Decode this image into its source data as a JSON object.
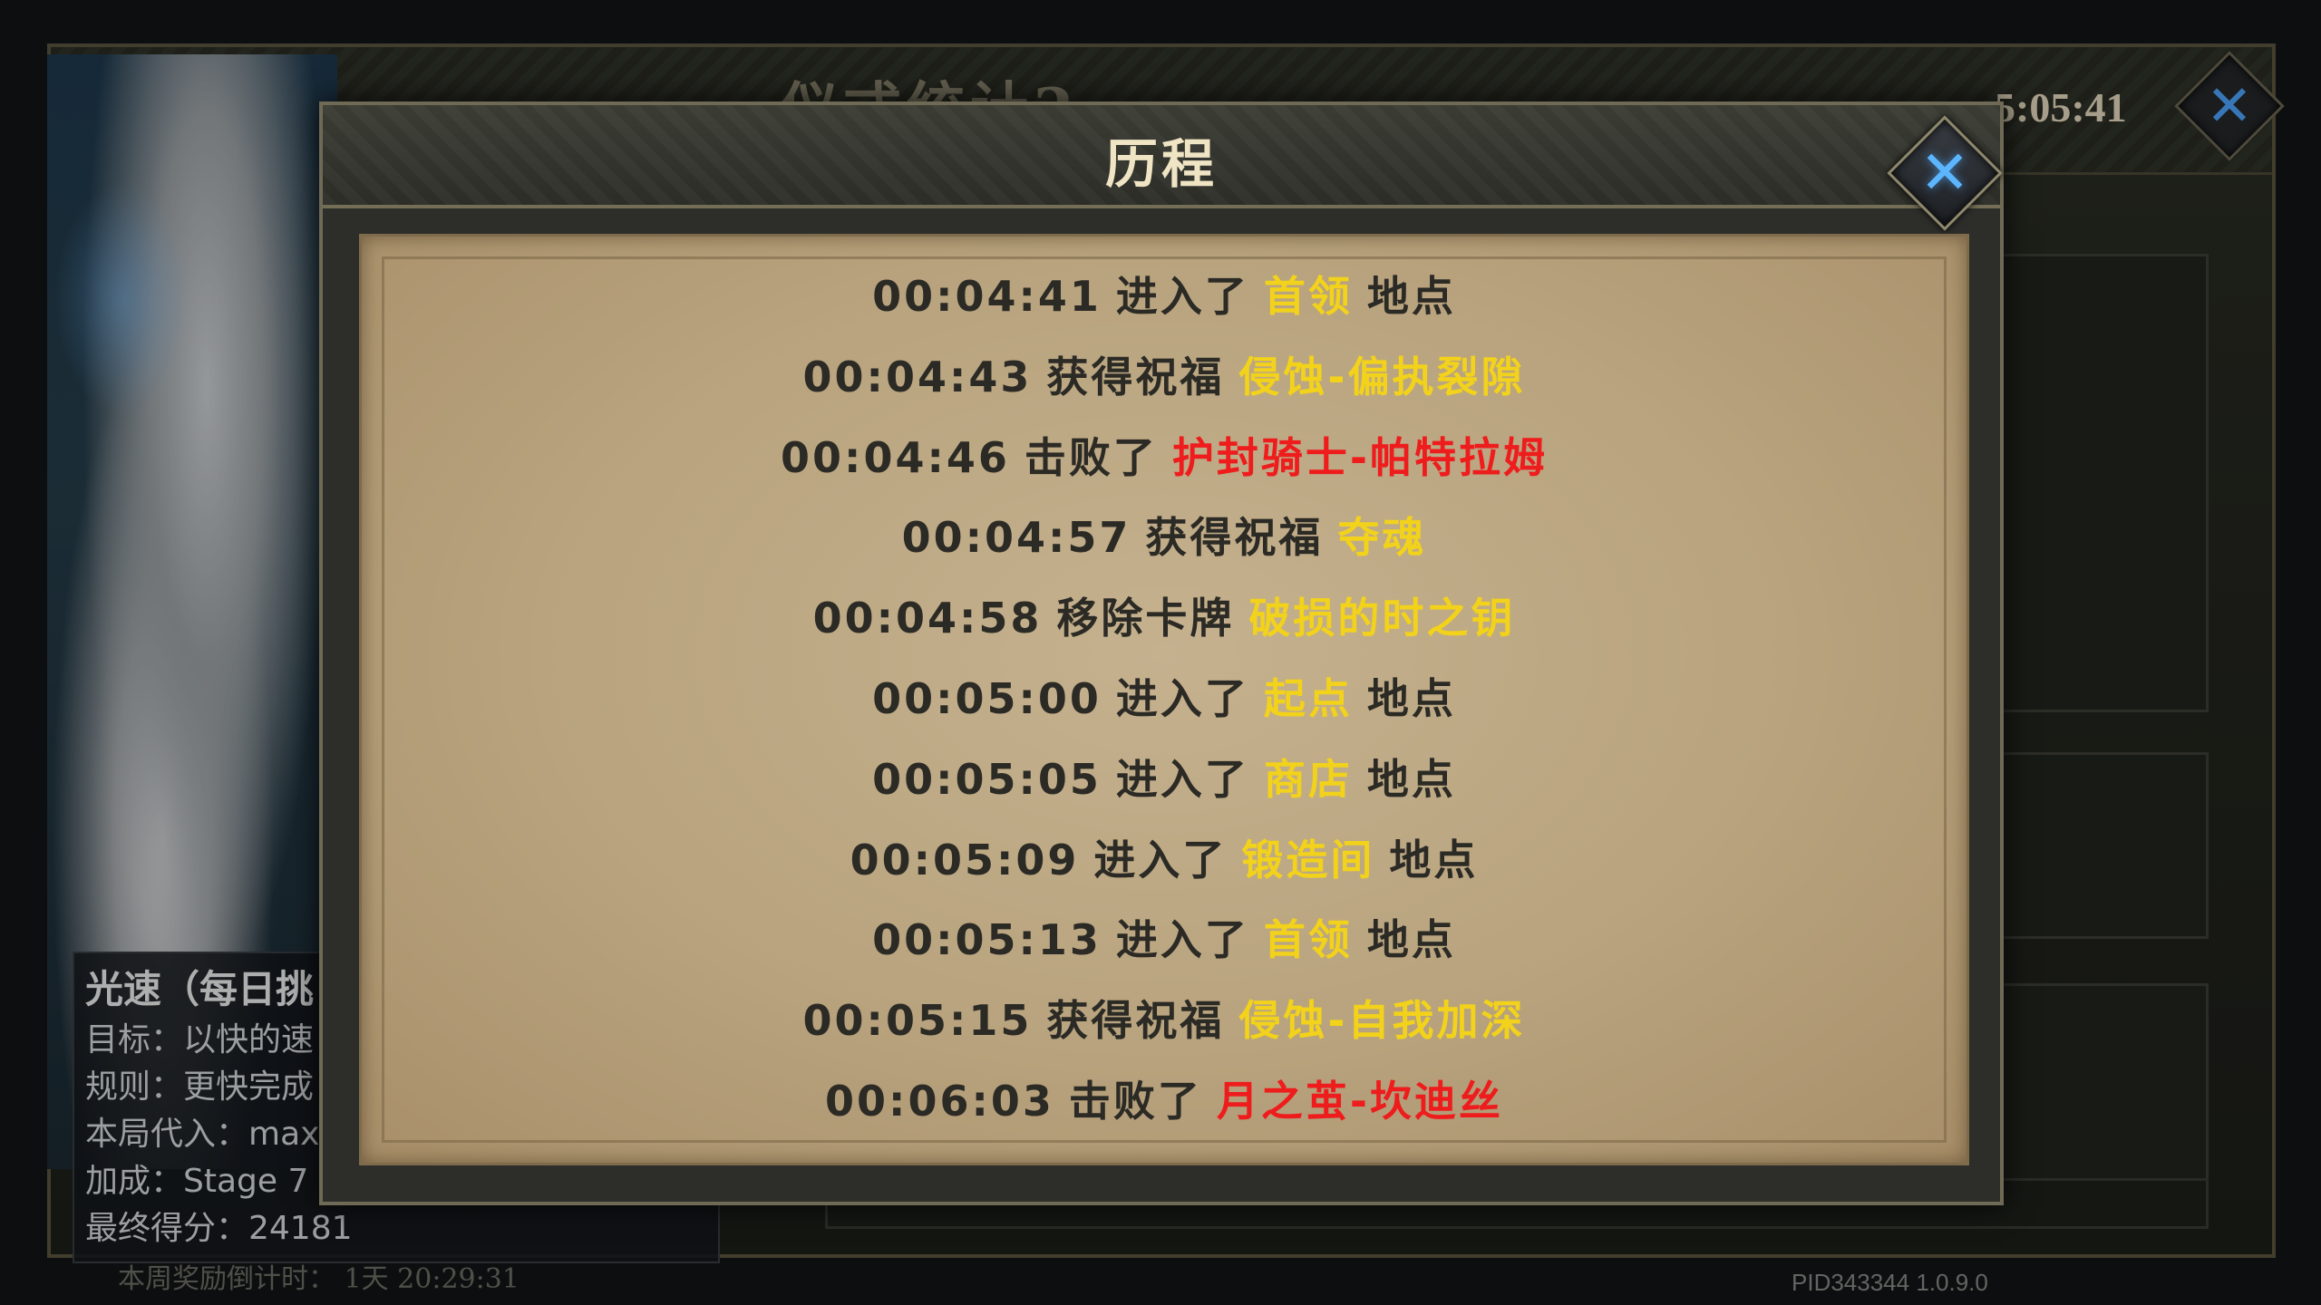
{
  "background": {
    "title_partial": "仪式统计2",
    "timer": "5:05:41",
    "info": {
      "title": "光速（每日挑",
      "lines": [
        "目标：以快的速",
        "规则：更快完成",
        "本局代入：max",
        "加成：Stage 7",
        "最终得分：24181"
      ]
    },
    "footer": "本周奖励倒计时：   1天 20:29:31",
    "pid": "PID343344  1.0.9.0"
  },
  "dialog": {
    "title": "历程",
    "close_icon": "close-x-icon",
    "entries": [
      {
        "time": "00:04:41",
        "verb": "进入了",
        "target": "首领",
        "suffix": "地点",
        "color": "#f2d21a"
      },
      {
        "time": "00:04:43",
        "verb": "获得祝福",
        "target": "侵蚀-偏执裂隙",
        "suffix": "",
        "color": "#f2d21a"
      },
      {
        "time": "00:04:46",
        "verb": "击败了",
        "target": "护封骑士-帕特拉姆",
        "suffix": "",
        "color": "#ee1c1c"
      },
      {
        "time": "00:04:57",
        "verb": "获得祝福",
        "target": "夺魂",
        "suffix": "",
        "color": "#f2d21a"
      },
      {
        "time": "00:04:58",
        "verb": "移除卡牌",
        "target": "破损的时之钥",
        "suffix": "",
        "color": "#f2d21a"
      },
      {
        "time": "00:05:00",
        "verb": "进入了",
        "target": "起点",
        "suffix": "地点",
        "color": "#f2d21a"
      },
      {
        "time": "00:05:05",
        "verb": "进入了",
        "target": "商店",
        "suffix": "地点",
        "color": "#f2d21a"
      },
      {
        "time": "00:05:09",
        "verb": "进入了",
        "target": "锻造间",
        "suffix": "地点",
        "color": "#f2d21a"
      },
      {
        "time": "00:05:13",
        "verb": "进入了",
        "target": "首领",
        "suffix": "地点",
        "color": "#f2d21a"
      },
      {
        "time": "00:05:15",
        "verb": "获得祝福",
        "target": "侵蚀-自我加深",
        "suffix": "",
        "color": "#f2d21a"
      },
      {
        "time": "00:06:03",
        "verb": "击败了",
        "target": "月之茧-坎迪丝",
        "suffix": "",
        "color": "#ee1c1c"
      }
    ]
  }
}
